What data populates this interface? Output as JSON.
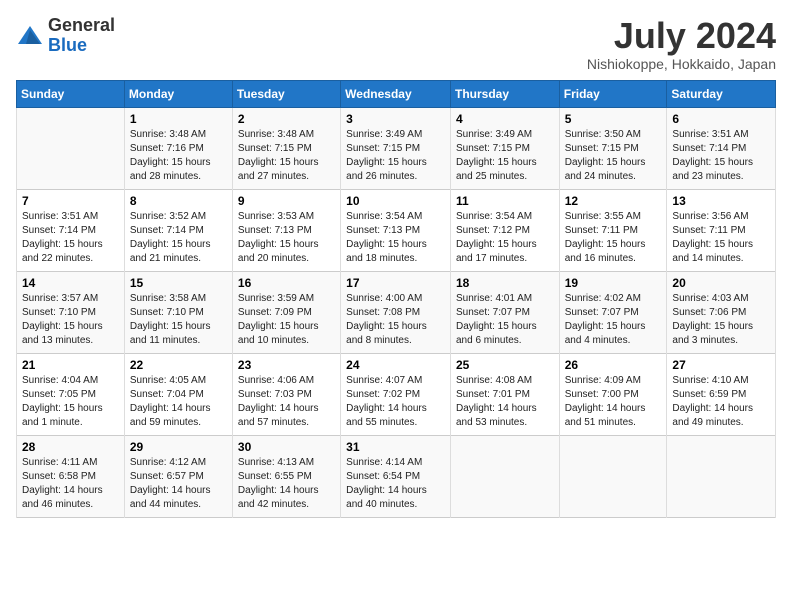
{
  "logo": {
    "general": "General",
    "blue": "Blue"
  },
  "title": "July 2024",
  "subtitle": "Nishiokoppe, Hokkaido, Japan",
  "days_of_week": [
    "Sunday",
    "Monday",
    "Tuesday",
    "Wednesday",
    "Thursday",
    "Friday",
    "Saturday"
  ],
  "weeks": [
    [
      {
        "day": "",
        "sunrise": "",
        "sunset": "",
        "daylight": ""
      },
      {
        "day": "1",
        "sunrise": "Sunrise: 3:48 AM",
        "sunset": "Sunset: 7:16 PM",
        "daylight": "Daylight: 15 hours and 28 minutes."
      },
      {
        "day": "2",
        "sunrise": "Sunrise: 3:48 AM",
        "sunset": "Sunset: 7:15 PM",
        "daylight": "Daylight: 15 hours and 27 minutes."
      },
      {
        "day": "3",
        "sunrise": "Sunrise: 3:49 AM",
        "sunset": "Sunset: 7:15 PM",
        "daylight": "Daylight: 15 hours and 26 minutes."
      },
      {
        "day": "4",
        "sunrise": "Sunrise: 3:49 AM",
        "sunset": "Sunset: 7:15 PM",
        "daylight": "Daylight: 15 hours and 25 minutes."
      },
      {
        "day": "5",
        "sunrise": "Sunrise: 3:50 AM",
        "sunset": "Sunset: 7:15 PM",
        "daylight": "Daylight: 15 hours and 24 minutes."
      },
      {
        "day": "6",
        "sunrise": "Sunrise: 3:51 AM",
        "sunset": "Sunset: 7:14 PM",
        "daylight": "Daylight: 15 hours and 23 minutes."
      }
    ],
    [
      {
        "day": "7",
        "sunrise": "Sunrise: 3:51 AM",
        "sunset": "Sunset: 7:14 PM",
        "daylight": "Daylight: 15 hours and 22 minutes."
      },
      {
        "day": "8",
        "sunrise": "Sunrise: 3:52 AM",
        "sunset": "Sunset: 7:14 PM",
        "daylight": "Daylight: 15 hours and 21 minutes."
      },
      {
        "day": "9",
        "sunrise": "Sunrise: 3:53 AM",
        "sunset": "Sunset: 7:13 PM",
        "daylight": "Daylight: 15 hours and 20 minutes."
      },
      {
        "day": "10",
        "sunrise": "Sunrise: 3:54 AM",
        "sunset": "Sunset: 7:13 PM",
        "daylight": "Daylight: 15 hours and 18 minutes."
      },
      {
        "day": "11",
        "sunrise": "Sunrise: 3:54 AM",
        "sunset": "Sunset: 7:12 PM",
        "daylight": "Daylight: 15 hours and 17 minutes."
      },
      {
        "day": "12",
        "sunrise": "Sunrise: 3:55 AM",
        "sunset": "Sunset: 7:11 PM",
        "daylight": "Daylight: 15 hours and 16 minutes."
      },
      {
        "day": "13",
        "sunrise": "Sunrise: 3:56 AM",
        "sunset": "Sunset: 7:11 PM",
        "daylight": "Daylight: 15 hours and 14 minutes."
      }
    ],
    [
      {
        "day": "14",
        "sunrise": "Sunrise: 3:57 AM",
        "sunset": "Sunset: 7:10 PM",
        "daylight": "Daylight: 15 hours and 13 minutes."
      },
      {
        "day": "15",
        "sunrise": "Sunrise: 3:58 AM",
        "sunset": "Sunset: 7:10 PM",
        "daylight": "Daylight: 15 hours and 11 minutes."
      },
      {
        "day": "16",
        "sunrise": "Sunrise: 3:59 AM",
        "sunset": "Sunset: 7:09 PM",
        "daylight": "Daylight: 15 hours and 10 minutes."
      },
      {
        "day": "17",
        "sunrise": "Sunrise: 4:00 AM",
        "sunset": "Sunset: 7:08 PM",
        "daylight": "Daylight: 15 hours and 8 minutes."
      },
      {
        "day": "18",
        "sunrise": "Sunrise: 4:01 AM",
        "sunset": "Sunset: 7:07 PM",
        "daylight": "Daylight: 15 hours and 6 minutes."
      },
      {
        "day": "19",
        "sunrise": "Sunrise: 4:02 AM",
        "sunset": "Sunset: 7:07 PM",
        "daylight": "Daylight: 15 hours and 4 minutes."
      },
      {
        "day": "20",
        "sunrise": "Sunrise: 4:03 AM",
        "sunset": "Sunset: 7:06 PM",
        "daylight": "Daylight: 15 hours and 3 minutes."
      }
    ],
    [
      {
        "day": "21",
        "sunrise": "Sunrise: 4:04 AM",
        "sunset": "Sunset: 7:05 PM",
        "daylight": "Daylight: 15 hours and 1 minute."
      },
      {
        "day": "22",
        "sunrise": "Sunrise: 4:05 AM",
        "sunset": "Sunset: 7:04 PM",
        "daylight": "Daylight: 14 hours and 59 minutes."
      },
      {
        "day": "23",
        "sunrise": "Sunrise: 4:06 AM",
        "sunset": "Sunset: 7:03 PM",
        "daylight": "Daylight: 14 hours and 57 minutes."
      },
      {
        "day": "24",
        "sunrise": "Sunrise: 4:07 AM",
        "sunset": "Sunset: 7:02 PM",
        "daylight": "Daylight: 14 hours and 55 minutes."
      },
      {
        "day": "25",
        "sunrise": "Sunrise: 4:08 AM",
        "sunset": "Sunset: 7:01 PM",
        "daylight": "Daylight: 14 hours and 53 minutes."
      },
      {
        "day": "26",
        "sunrise": "Sunrise: 4:09 AM",
        "sunset": "Sunset: 7:00 PM",
        "daylight": "Daylight: 14 hours and 51 minutes."
      },
      {
        "day": "27",
        "sunrise": "Sunrise: 4:10 AM",
        "sunset": "Sunset: 6:59 PM",
        "daylight": "Daylight: 14 hours and 49 minutes."
      }
    ],
    [
      {
        "day": "28",
        "sunrise": "Sunrise: 4:11 AM",
        "sunset": "Sunset: 6:58 PM",
        "daylight": "Daylight: 14 hours and 46 minutes."
      },
      {
        "day": "29",
        "sunrise": "Sunrise: 4:12 AM",
        "sunset": "Sunset: 6:57 PM",
        "daylight": "Daylight: 14 hours and 44 minutes."
      },
      {
        "day": "30",
        "sunrise": "Sunrise: 4:13 AM",
        "sunset": "Sunset: 6:55 PM",
        "daylight": "Daylight: 14 hours and 42 minutes."
      },
      {
        "day": "31",
        "sunrise": "Sunrise: 4:14 AM",
        "sunset": "Sunset: 6:54 PM",
        "daylight": "Daylight: 14 hours and 40 minutes."
      },
      {
        "day": "",
        "sunrise": "",
        "sunset": "",
        "daylight": ""
      },
      {
        "day": "",
        "sunrise": "",
        "sunset": "",
        "daylight": ""
      },
      {
        "day": "",
        "sunrise": "",
        "sunset": "",
        "daylight": ""
      }
    ]
  ]
}
